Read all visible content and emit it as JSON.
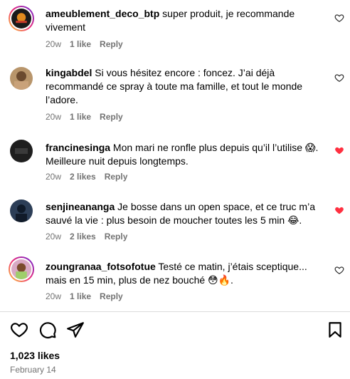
{
  "comments": [
    {
      "username": "ameublement_deco_btp",
      "text": "super produit, je recommande vivement",
      "time": "20w",
      "likes": "1 like",
      "reply": "Reply",
      "liked": false
    },
    {
      "username": "kingabdel",
      "text": "Si vous hésitez encore : foncez. J’ai déjà recommandé ce spray à toute ma famille, et tout le monde l’adore.",
      "time": "20w",
      "likes": "1 like",
      "reply": "Reply",
      "liked": false
    },
    {
      "username": "francinesinga",
      "text": "Mon mari ne ronfle plus depuis qu’il l’utilise 😱.",
      "text2": "Meilleure nuit depuis longtemps.",
      "time": "20w",
      "likes": "2 likes",
      "reply": "Reply",
      "liked": true
    },
    {
      "username": "senjineananga",
      "text": "Je bosse dans un open space, et ce truc m’a sauvé la vie : plus besoin de moucher toutes les 5 min 😂.",
      "time": "20w",
      "likes": "2 likes",
      "reply": "Reply",
      "liked": true
    },
    {
      "username": "zoungranaa_fotsofotue",
      "text": "Testé ce matin, j’étais sceptique... mais en 15 min, plus de nez bouché 😳🔥.",
      "time": "20w",
      "likes": "1 like",
      "reply": "Reply",
      "liked": false
    }
  ],
  "footer": {
    "likes": "1,023 likes",
    "date": "February 14"
  },
  "colors": {
    "liked_heart": "#ff3040",
    "meta_text": "#737373",
    "divider": "#dbdbdb"
  },
  "icons": {
    "comment_like": "heart-icon",
    "post_like": "heart-icon",
    "comment": "comment-icon",
    "share": "send-icon",
    "save": "bookmark-icon"
  }
}
